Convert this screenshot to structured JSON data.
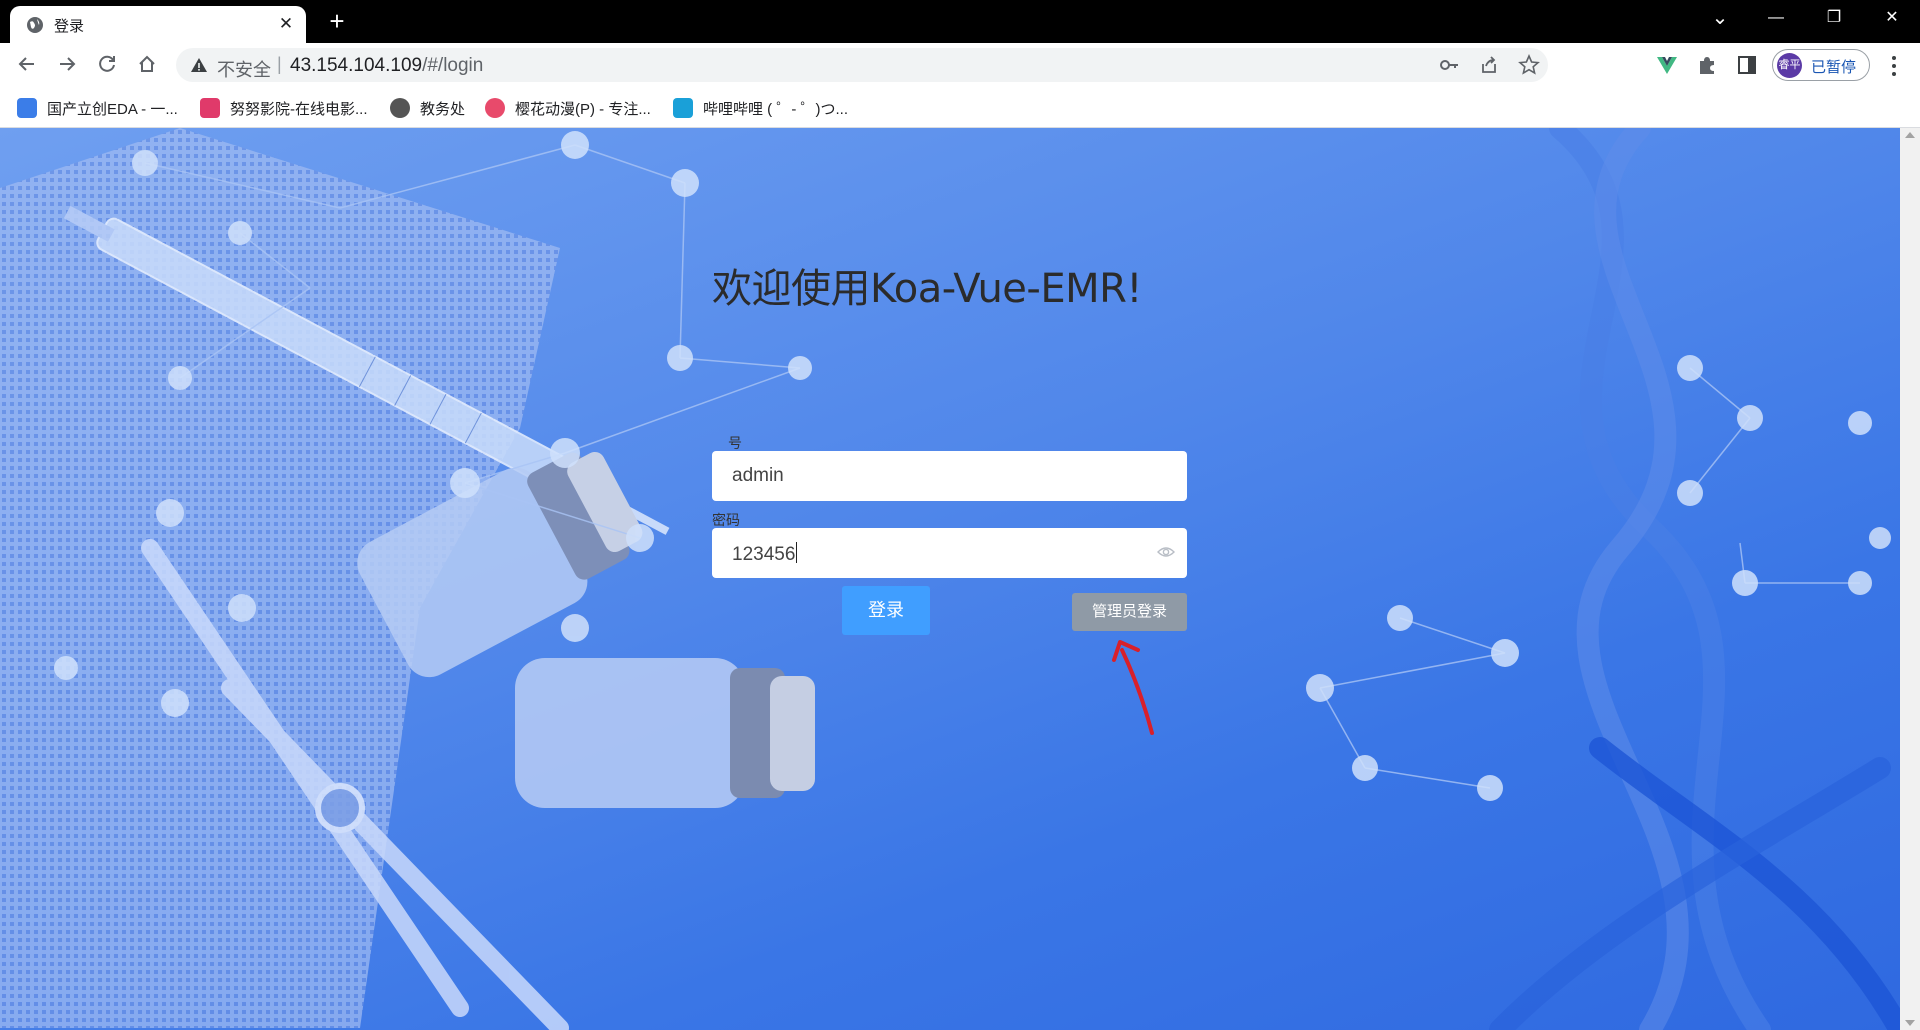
{
  "browser": {
    "tab": {
      "title": "登录",
      "close": "✕"
    },
    "new_tab": "+",
    "window_controls": {
      "dropdown": "⌄",
      "minimize": "—",
      "restore": "❐",
      "close": "✕"
    },
    "address": {
      "security_label": "不安全",
      "separator": "|",
      "host": "43.154.104.109",
      "path": "/#/login"
    },
    "profile": {
      "avatar_text": "睿平",
      "status": "已暂停"
    }
  },
  "bookmarks": [
    {
      "label": "国产立创EDA - 一...",
      "color": "#3b7de8"
    },
    {
      "label": "努努影院-在线电影...",
      "color": "#e03a6a"
    },
    {
      "label": "教务处",
      "color": "#555555"
    },
    {
      "label": "樱花动漫(P) - 专注...",
      "color": "#e84a6b"
    },
    {
      "label": "哔哩哔哩 ( ゜- ゜)つ...",
      "color": "#1aa0d8"
    }
  ],
  "login": {
    "title": "欢迎使用Koa-Vue-EMR!",
    "account_label": "号",
    "account_value": "admin",
    "password_label": "密码",
    "password_value": "123456",
    "login_button": "登录",
    "admin_button": "管理员登录"
  },
  "colors": {
    "primary_button": "#409eff",
    "admin_button": "#8f9aa6",
    "annotation_arrow": "#d9202a",
    "page_background": "#4f86ea"
  }
}
